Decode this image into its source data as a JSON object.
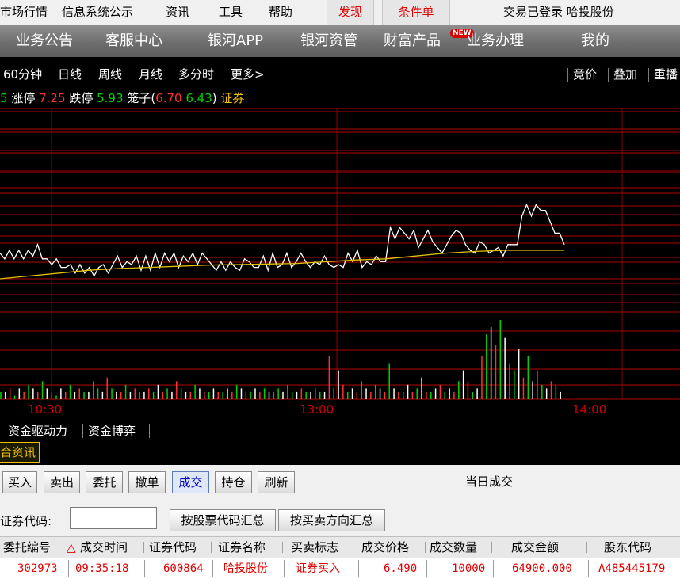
{
  "menu": {
    "items": [
      "市场行情",
      "信息系统公示",
      "资讯",
      "工具",
      "帮助"
    ],
    "tabs": [
      "发现",
      "条件单"
    ],
    "status": "交易已登录 哈投股份"
  },
  "nav": {
    "items": [
      "业务公告",
      "客服中心",
      "银河APP",
      "银河资管",
      "财富产品",
      "业务办理",
      "我的"
    ],
    "badge": "NEW"
  },
  "periods": {
    "items": [
      "60分钟",
      "日线",
      "周线",
      "月线",
      "多分时",
      "更多>"
    ],
    "right": [
      "竞价",
      "叠加",
      "重播"
    ]
  },
  "info": {
    "prefix": "5",
    "limit_up_label": "涨停",
    "limit_up": "7.25",
    "limit_down_label": "跌停",
    "limit_down": "5.93",
    "cage_label": "笼子",
    "cage_high": "6.70",
    "cage_low": "6.43",
    "sector": "证券"
  },
  "chart_data": {
    "type": "line",
    "x_ticks": [
      "10:30",
      "13:00",
      "14:00"
    ],
    "series": [
      {
        "values": [
          6.545,
          6.535,
          6.55,
          6.535,
          6.55,
          6.535,
          6.55,
          6.54,
          6.56,
          6.535,
          6.535,
          6.525,
          6.535,
          6.52,
          6.52,
          6.525,
          6.51,
          6.525,
          6.51,
          6.52,
          6.505,
          6.52,
          6.525,
          6.51,
          6.525,
          6.54,
          6.52,
          6.53,
          6.525,
          6.54,
          6.515,
          6.54,
          6.515,
          6.545,
          6.52,
          6.545,
          6.53,
          6.545,
          6.52,
          6.54,
          6.53,
          6.545,
          6.525,
          6.545,
          6.535,
          6.525,
          6.515,
          6.53,
          6.515,
          6.53,
          6.52,
          6.515,
          6.535,
          6.53,
          6.52,
          6.52,
          6.54,
          6.515,
          6.545,
          6.52,
          6.525,
          6.545,
          6.52,
          6.53,
          6.545,
          6.53,
          6.52,
          6.53,
          6.525,
          6.54,
          6.525,
          6.52,
          6.525,
          6.52,
          6.545,
          6.53,
          6.55,
          6.52,
          6.53,
          6.525,
          6.54,
          6.53,
          6.53,
          6.59,
          6.57,
          6.59,
          6.58,
          6.57,
          6.585,
          6.555,
          6.57,
          6.585,
          6.565,
          6.555,
          6.545,
          6.56,
          6.575,
          6.585,
          6.58,
          6.56,
          6.55,
          6.545,
          6.565,
          6.56,
          6.545,
          6.55,
          6.555,
          6.54,
          6.56,
          6.56,
          6.56,
          6.61,
          6.63,
          6.61,
          6.63,
          6.62,
          6.62,
          6.6,
          6.58,
          6.58,
          6.56
        ]
      },
      {
        "values": [
          6.5,
          6.505,
          6.51,
          6.515,
          6.518,
          6.52,
          6.522,
          6.524,
          6.525,
          6.526,
          6.527,
          6.53,
          6.533,
          6.535,
          6.54,
          6.545,
          6.548,
          6.55,
          6.55,
          6.55
        ]
      }
    ],
    "volume": [
      2,
      2,
      3,
      1,
      3,
      2,
      4,
      3,
      2,
      5,
      3,
      2,
      1,
      3,
      2,
      4,
      2,
      3,
      2,
      2,
      5,
      3,
      2,
      6,
      3,
      2,
      2,
      4,
      2,
      3,
      2,
      2,
      3,
      2,
      4,
      2,
      3,
      2,
      5,
      3,
      2,
      2,
      4,
      3,
      2,
      2,
      3,
      2,
      2,
      3,
      2,
      4,
      3,
      2,
      2,
      3,
      2,
      3,
      2,
      2,
      3,
      2,
      4,
      2,
      2,
      3,
      2,
      2,
      3,
      2,
      2,
      12,
      3,
      8,
      4,
      2,
      3,
      2,
      5,
      3,
      2,
      4,
      3,
      2,
      10,
      3,
      2,
      2,
      4,
      2,
      3,
      6,
      2,
      2,
      3,
      4,
      2,
      3,
      2,
      5,
      8,
      5,
      2,
      3,
      12,
      18,
      20,
      15,
      22,
      17,
      10,
      8,
      14,
      6,
      12,
      5,
      8,
      4,
      3,
      5,
      4,
      2
    ]
  },
  "lower_tabs": [
    "资金驱动力",
    "资金博弈"
  ],
  "news_tab": "合资讯",
  "panel": {
    "buttons": [
      "买入",
      "卖出",
      "委托",
      "撤单",
      "成交",
      "持仓",
      "刷新"
    ],
    "title": "当日成交",
    "query_label": "证券代码:",
    "query_buttons": [
      "按股票代码汇总",
      "按买卖方向汇总"
    ],
    "columns": [
      "委托编号",
      "成交时间",
      "证券代码",
      "证券名称",
      "买卖标志",
      "成交价格",
      "成交数量",
      "成交金额",
      "股东代码"
    ],
    "sort_indicator": "△",
    "rows": [
      [
        "302973",
        "09:35:18",
        "600864",
        "哈投股份",
        "证券买入",
        "6.490",
        "10000",
        "64900.000",
        "A485445179"
      ]
    ]
  }
}
